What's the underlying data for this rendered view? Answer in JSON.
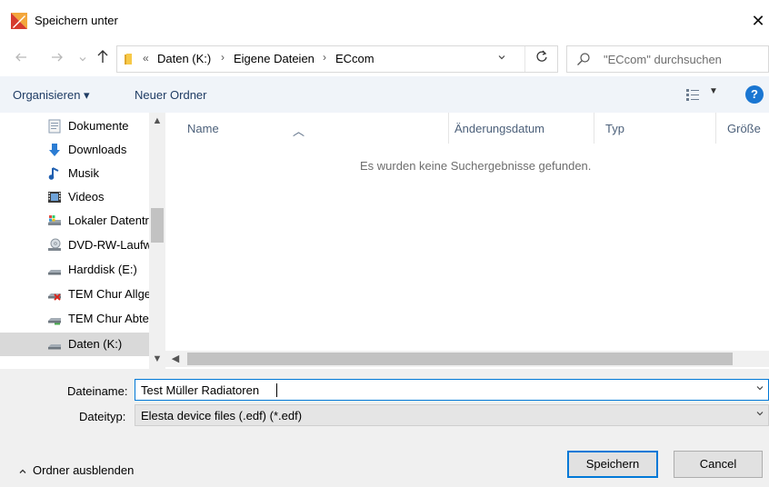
{
  "window": {
    "title": "Speichern unter",
    "close_glyph": "✕"
  },
  "nav": {
    "back_icon": "arrow-left-icon",
    "forward_icon": "arrow-right-icon",
    "recent_icon": "chevron-down-icon",
    "up_icon": "arrow-up-icon",
    "address_more": "«",
    "breadcrumbs": [
      "Daten (K:)",
      "Eigene Dateien",
      "ECcom"
    ],
    "separator": "›",
    "refresh_icon": "refresh-icon",
    "search_placeholder": "\"ECcom\" durchsuchen"
  },
  "toolbar": {
    "organize": "Organisieren ▾",
    "new_folder": "Neuer Ordner",
    "view_icon": "view-options-icon",
    "help": "?"
  },
  "sidebar": {
    "items": [
      {
        "label": "Dokumente",
        "icon": "documents-icon"
      },
      {
        "label": "Downloads",
        "icon": "download-icon"
      },
      {
        "label": "Musik",
        "icon": "music-icon"
      },
      {
        "label": "Videos",
        "icon": "video-icon"
      },
      {
        "label": "Lokaler Datenträger",
        "icon": "local-drive-icon"
      },
      {
        "label": "DVD-RW-Laufwerk",
        "icon": "dvd-drive-icon"
      },
      {
        "label": "Harddisk (E:)",
        "icon": "drive-icon"
      },
      {
        "label": "TEM Chur Allgemein",
        "icon": "network-drive-disconnected-icon"
      },
      {
        "label": "TEM Chur Abteilung",
        "icon": "network-drive-icon"
      },
      {
        "label": "Daten (K:)",
        "icon": "drive-icon",
        "selected": true
      }
    ]
  },
  "file_list": {
    "columns": [
      "Name",
      "Änderungsdatum",
      "Typ",
      "Größe"
    ],
    "empty_message": "Es wurden keine Suchergebnisse gefunden."
  },
  "form": {
    "filename_label": "Dateiname:",
    "filename_value": "Test Müller Radiatoren",
    "filetype_label": "Dateityp:",
    "filetype_value": "Elesta device files (.edf) (*.edf)"
  },
  "footer": {
    "hide_folders": "Ordner ausblenden",
    "save": "Speichern",
    "cancel": "Cancel"
  },
  "colors": {
    "accent": "#0078d7",
    "toolbar_bg": "#f0f4f9",
    "link_text": "#1f3c64"
  }
}
